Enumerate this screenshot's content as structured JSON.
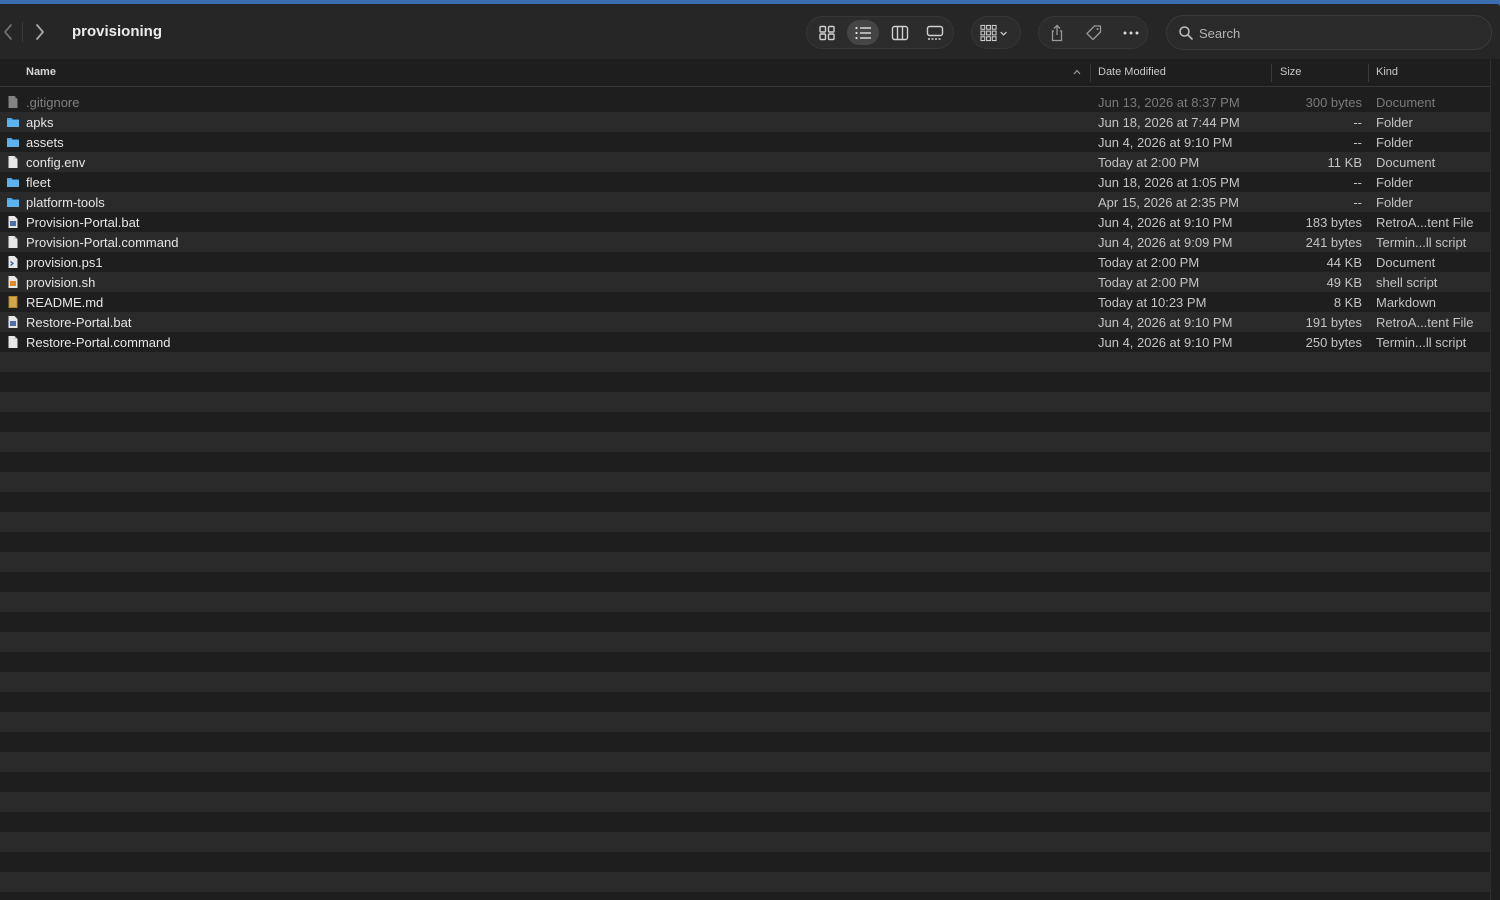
{
  "window": {
    "title": "provisioning"
  },
  "toolbar": {
    "views": [
      "icon-view",
      "list-view",
      "column-view",
      "gallery-view"
    ],
    "active_view": "list-view",
    "search_placeholder": "Search"
  },
  "columns": {
    "name": "Name",
    "date": "Date Modified",
    "size": "Size",
    "kind": "Kind"
  },
  "files": [
    {
      "name": ".gitignore",
      "date": "Jun 13, 2026 at 8:37 PM",
      "size": "300 bytes",
      "kind": "Document",
      "icon": "document-icon",
      "dim": true
    },
    {
      "name": "apks",
      "date": "Jun 18, 2026 at 7:44 PM",
      "size": "--",
      "kind": "Folder",
      "icon": "folder-icon",
      "dim": false
    },
    {
      "name": "assets",
      "date": "Jun 4, 2026 at 9:10 PM",
      "size": "--",
      "kind": "Folder",
      "icon": "folder-icon",
      "dim": false
    },
    {
      "name": "config.env",
      "date": "Today at 2:00 PM",
      "size": "11 KB",
      "kind": "Document",
      "icon": "document-icon",
      "dim": false
    },
    {
      "name": "fleet",
      "date": "Jun 18, 2026 at 1:05 PM",
      "size": "--",
      "kind": "Folder",
      "icon": "folder-icon",
      "dim": false
    },
    {
      "name": "platform-tools",
      "date": "Apr 15, 2026 at 2:35 PM",
      "size": "--",
      "kind": "Folder",
      "icon": "folder-icon",
      "dim": false
    },
    {
      "name": "Provision-Portal.bat",
      "date": "Jun 4, 2026 at 9:10 PM",
      "size": "183 bytes",
      "kind": "RetroA...tent File",
      "icon": "script-file-icon",
      "dim": false
    },
    {
      "name": "Provision-Portal.command",
      "date": "Jun 4, 2026 at 9:09 PM",
      "size": "241 bytes",
      "kind": "Termin...ll script",
      "icon": "document-icon",
      "dim": false
    },
    {
      "name": "provision.ps1",
      "date": "Today at 2:00 PM",
      "size": "44 KB",
      "kind": "Document",
      "icon": "powershell-file-icon",
      "dim": false
    },
    {
      "name": "provision.sh",
      "date": "Today at 2:00 PM",
      "size": "49 KB",
      "kind": "shell script",
      "icon": "shell-script-icon",
      "dim": false
    },
    {
      "name": "README.md",
      "date": "Today at 10:23 PM",
      "size": "8 KB",
      "kind": "Markdown",
      "icon": "markdown-file-icon",
      "dim": false
    },
    {
      "name": "Restore-Portal.bat",
      "date": "Jun 4, 2026 at 9:10 PM",
      "size": "191 bytes",
      "kind": "RetroA...tent File",
      "icon": "script-file-icon",
      "dim": false
    },
    {
      "name": "Restore-Portal.command",
      "date": "Jun 4, 2026 at 9:10 PM",
      "size": "250 bytes",
      "kind": "Termin...ll script",
      "icon": "document-icon",
      "dim": false
    }
  ],
  "colors": {
    "accent_folder": "#4aa3e8",
    "background": "#1e1e1e",
    "stripe": "#2a2a2a"
  }
}
